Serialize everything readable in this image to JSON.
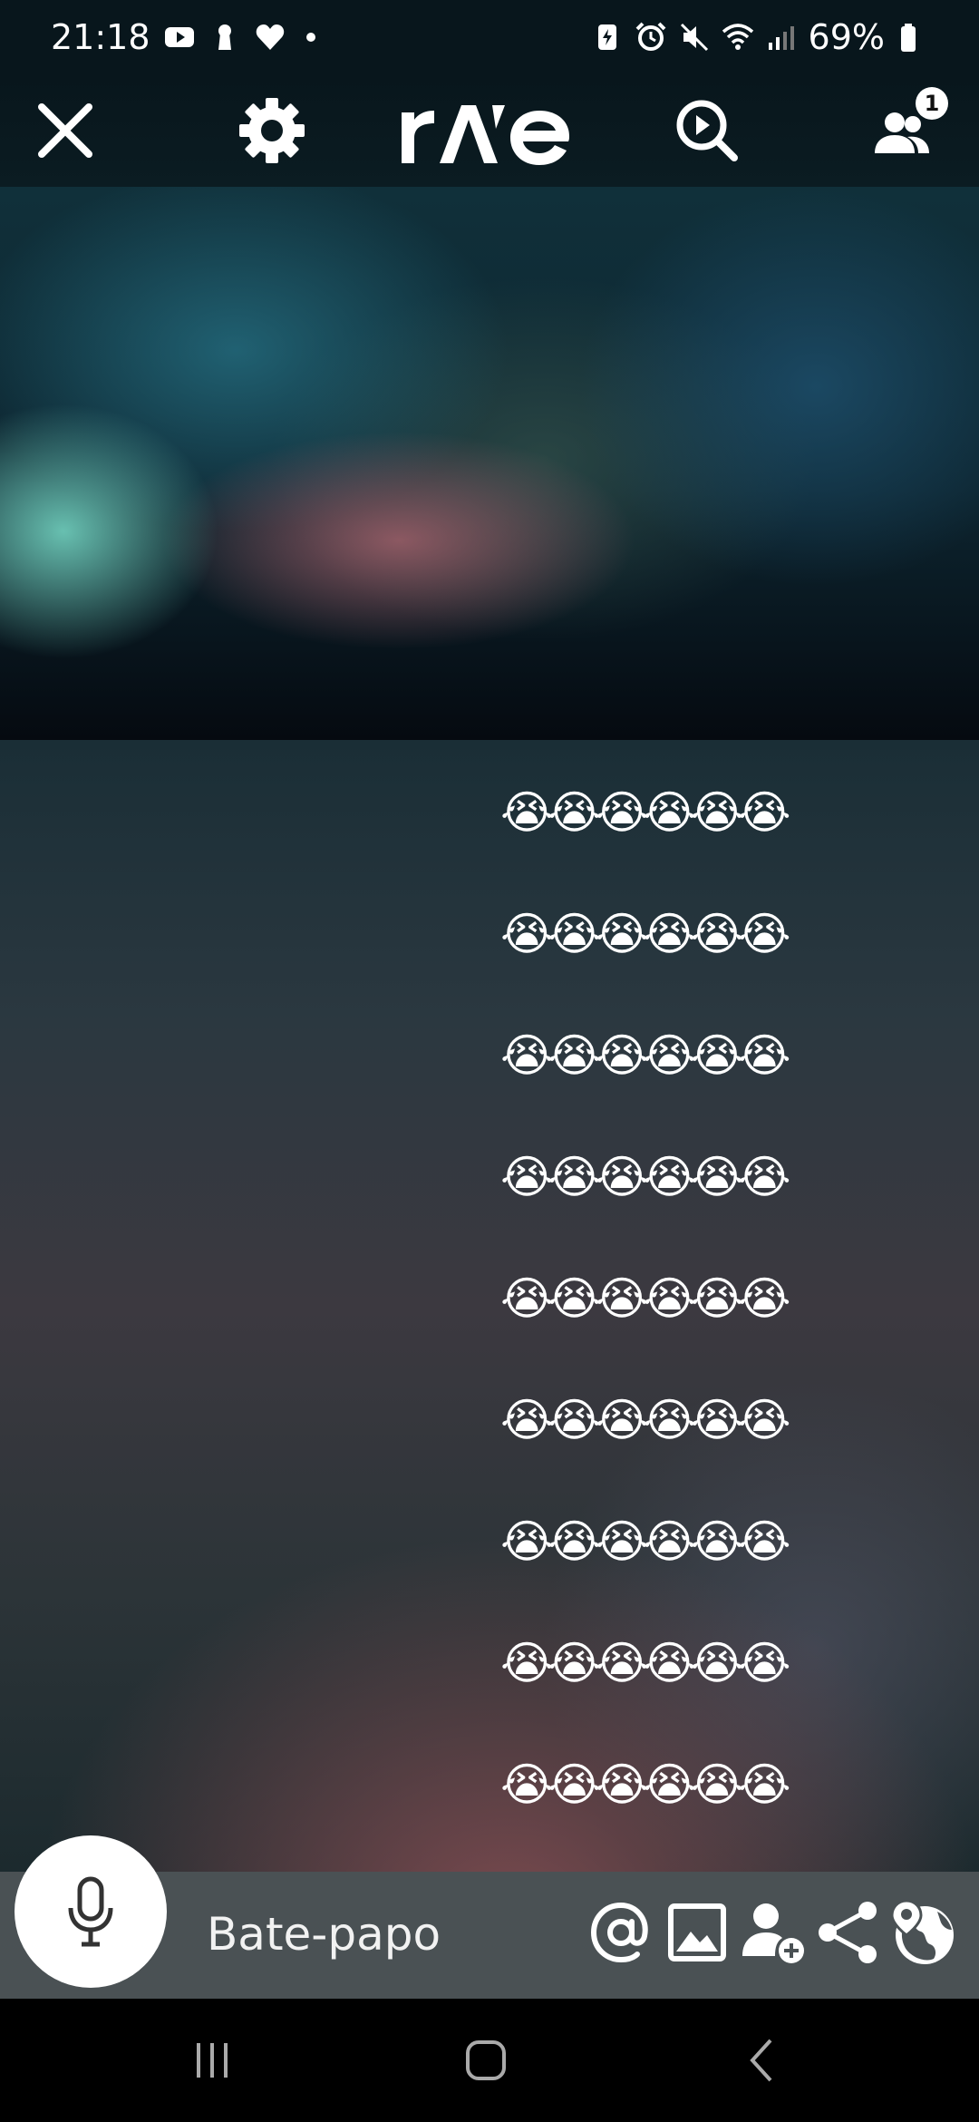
{
  "status_bar": {
    "time": "21:18",
    "battery": "69%"
  },
  "app_bar": {
    "logo_text": "rave",
    "participants_badge": "1"
  },
  "chat": {
    "messages": [
      "😭😭😭😭😭😭",
      "😭😭😭😭😭😭",
      "😭😭😭😭😭😭",
      "😭😭😭😭😭😭",
      "😭😭😭😭😭😭",
      "😭😭😭😭😭😭",
      "😭😭😭😭😭😭",
      "😭😭😭😭😭😭",
      "😭😭😭😭😭😭"
    ]
  },
  "input_bar": {
    "placeholder": "Bate-papo"
  },
  "icons": {
    "close": "close-icon",
    "settings": "gear-icon",
    "search_video": "play-search-icon",
    "participants": "people-icon",
    "mic": "microphone-icon",
    "mention": "at-icon",
    "image": "image-icon",
    "add_user": "add-user-icon",
    "share": "share-icon",
    "globe": "globe-location-icon"
  }
}
